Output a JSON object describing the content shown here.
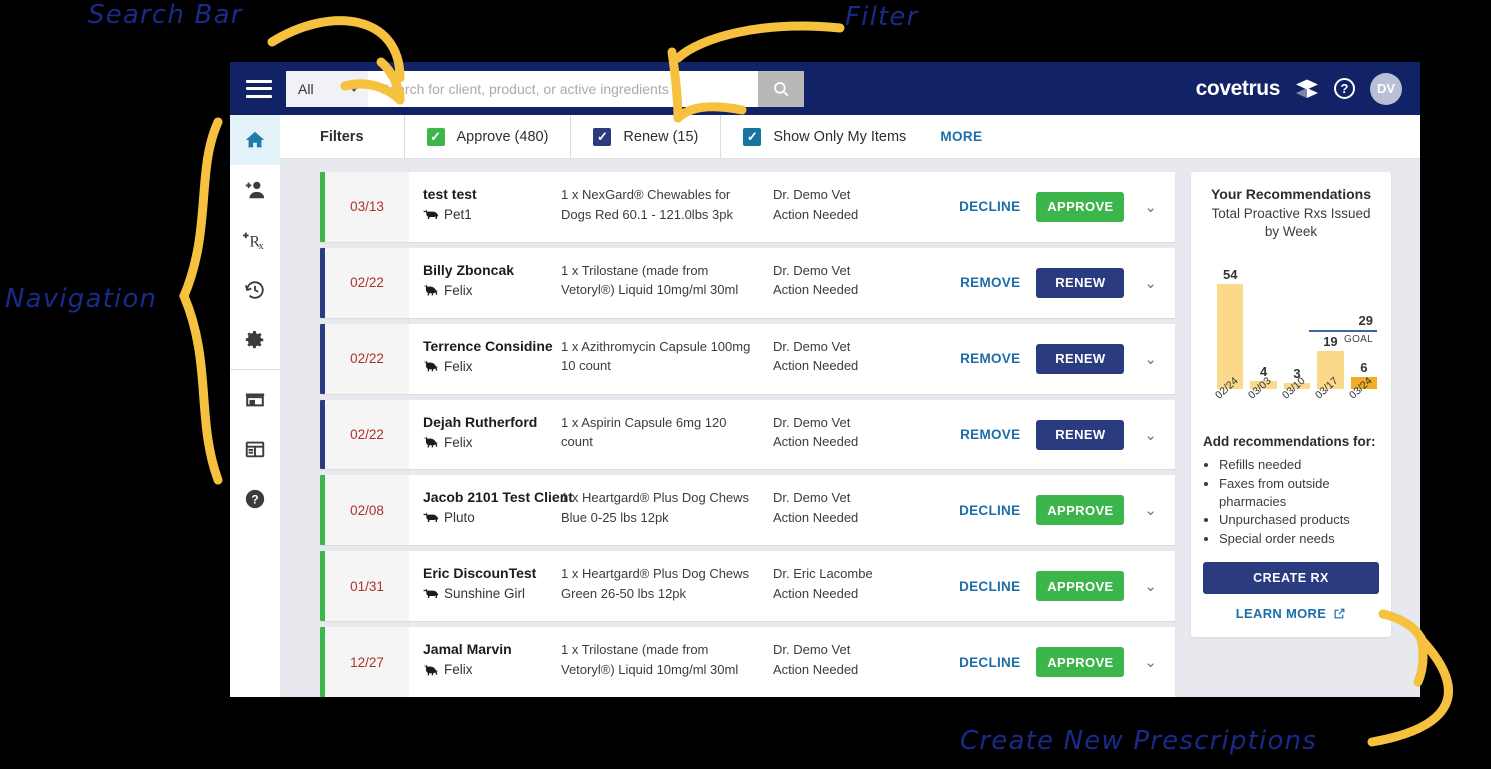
{
  "topbar": {
    "menu_icon": "hamburger-icon",
    "search_scope_value": "All",
    "search_placeholder": "Search for client, product, or active ingredients",
    "search_icon": "search-icon",
    "brand_name": "covetrus",
    "brand_mark_icon": "covetrus-diamond-icon",
    "help_icon": "question-mark-icon",
    "help_label": "?",
    "avatar_initials": "DV"
  },
  "sidebar": {
    "items": [
      {
        "name": "home",
        "icon": "home-icon",
        "active": true
      },
      {
        "name": "add-client",
        "icon": "add-person-icon",
        "active": false
      },
      {
        "name": "new-prescription",
        "icon": "add-rx-icon",
        "active": false
      },
      {
        "name": "history",
        "icon": "history-clock-icon",
        "active": false
      },
      {
        "name": "settings",
        "icon": "gear-icon",
        "active": false
      },
      {
        "name": "store",
        "icon": "store-icon",
        "active": false
      },
      {
        "name": "reports",
        "icon": "calendar-card-icon",
        "active": false
      },
      {
        "name": "help",
        "icon": "question-circle-icon",
        "active": false
      }
    ]
  },
  "filterbar": {
    "title": "Filters",
    "items": [
      {
        "label": "Approve (480)",
        "checked": true,
        "color": "#3cb54a"
      },
      {
        "label": "Renew (15)",
        "checked": true,
        "color": "#2a3b80"
      },
      {
        "label": "Show Only My Items",
        "checked": true,
        "color": "#15759e"
      }
    ],
    "more_label": "MORE"
  },
  "rows": [
    {
      "date": "03/13",
      "bar_color": "#3cb54a",
      "client": "test test",
      "pet": "Pet1",
      "pet_icon": "dog-icon",
      "product": "1 x NexGard® Chewables for Dogs Red 60.1 - 121.0lbs 3pk",
      "vet": "Dr. Demo Vet",
      "status": "Action Needed",
      "link_label": "DECLINE",
      "button_label": "APPROVE",
      "button_kind": "approve",
      "chevron_icon": "chevron-down-icon"
    },
    {
      "date": "02/22",
      "bar_color": "#2a3b80",
      "client": "Billy Zboncak",
      "pet": "Felix",
      "pet_icon": "cat-icon",
      "product": "1 x Trilostane (made from Vetoryl®) Liquid 10mg/ml 30ml",
      "vet": "Dr. Demo Vet",
      "status": "Action Needed",
      "link_label": "REMOVE",
      "button_label": "RENEW",
      "button_kind": "renew",
      "chevron_icon": "chevron-down-icon"
    },
    {
      "date": "02/22",
      "bar_color": "#2a3b80",
      "client": "Terrence Considine",
      "pet": "Felix",
      "pet_icon": "cat-icon",
      "product": "1 x Azithromycin Capsule 100mg 10 count",
      "vet": "Dr. Demo Vet",
      "status": "Action Needed",
      "link_label": "REMOVE",
      "button_label": "RENEW",
      "button_kind": "renew",
      "chevron_icon": "chevron-down-icon"
    },
    {
      "date": "02/22",
      "bar_color": "#2a3b80",
      "client": "Dejah Rutherford",
      "pet": "Felix",
      "pet_icon": "cat-icon",
      "product": "1 x Aspirin Capsule 6mg 120 count",
      "vet": "Dr. Demo Vet",
      "status": "Action Needed",
      "link_label": "REMOVE",
      "button_label": "RENEW",
      "button_kind": "renew",
      "chevron_icon": "chevron-down-icon"
    },
    {
      "date": "02/08",
      "bar_color": "#3cb54a",
      "client": "Jacob 2101 Test Client",
      "pet": "Pluto",
      "pet_icon": "dog-icon",
      "product": "1 x Heartgard® Plus Dog Chews Blue 0-25 lbs 12pk",
      "vet": "Dr. Demo Vet",
      "status": "Action Needed",
      "link_label": "DECLINE",
      "button_label": "APPROVE",
      "button_kind": "approve",
      "chevron_icon": "chevron-down-icon"
    },
    {
      "date": "01/31",
      "bar_color": "#3cb54a",
      "client": "Eric DiscounTest",
      "pet": "Sunshine Girl",
      "pet_icon": "dog-icon",
      "product": "1 x Heartgard® Plus Dog Chews Green 26-50 lbs 12pk",
      "vet": "Dr. Eric Lacombe",
      "status": "Action Needed",
      "link_label": "DECLINE",
      "button_label": "APPROVE",
      "button_kind": "approve",
      "chevron_icon": "chevron-down-icon"
    },
    {
      "date": "12/27",
      "bar_color": "#3cb54a",
      "client": "Jamal Marvin",
      "pet": "Felix",
      "pet_icon": "cat-icon",
      "product": "1 x Trilostane (made from Vetoryl®) Liquid 10mg/ml 30ml",
      "vet": "Dr. Demo Vet",
      "status": "Action Needed",
      "link_label": "DECLINE",
      "button_label": "APPROVE",
      "button_kind": "approve",
      "chevron_icon": "chevron-down-icon"
    }
  ],
  "recommendations": {
    "title": "Your Recommendations",
    "subtitle": "Total Proactive Rxs Issued by Week",
    "add_heading": "Add recommendations for:",
    "bullets": [
      "Refills needed",
      "Faxes from outside pharmacies",
      "Unpurchased products",
      "Special order needs"
    ],
    "create_rx_label": "CREATE RX",
    "learn_more_label": "LEARN MORE",
    "external_link_icon": "external-link-icon"
  },
  "chart_data": {
    "type": "bar",
    "title": "Total Proactive Rxs Issued by Week",
    "categories": [
      "02/24",
      "03/03",
      "03/10",
      "03/17",
      "03/24"
    ],
    "values": [
      54,
      4,
      3,
      19,
      6
    ],
    "bar_colors": [
      "#fbd98a",
      "#fbd98a",
      "#fbd98a",
      "#fbd98a",
      "#f0ad28"
    ],
    "goal": 29,
    "goal_label": "GOAL",
    "goal_color": "#3c66a8",
    "xlabel": "",
    "ylabel": "",
    "ylim": [
      0,
      60
    ],
    "grid": false,
    "legend": "none",
    "data_labels": true
  },
  "annotations": [
    {
      "text": "Search Bar",
      "name": "annotation-search-bar"
    },
    {
      "text": "Filter",
      "name": "annotation-filter"
    },
    {
      "text": "Navigation",
      "name": "annotation-navigation"
    },
    {
      "text": "Create New Prescriptions",
      "name": "annotation-create-prescriptions"
    }
  ],
  "colors": {
    "brand_navy": "#112266",
    "approve_green": "#3cb54a",
    "renew_navy": "#2a3b80",
    "link_blue": "#1d6ea8",
    "annotation_ink": "#1a2a8a",
    "annotation_arrow": "#f5c13e"
  }
}
